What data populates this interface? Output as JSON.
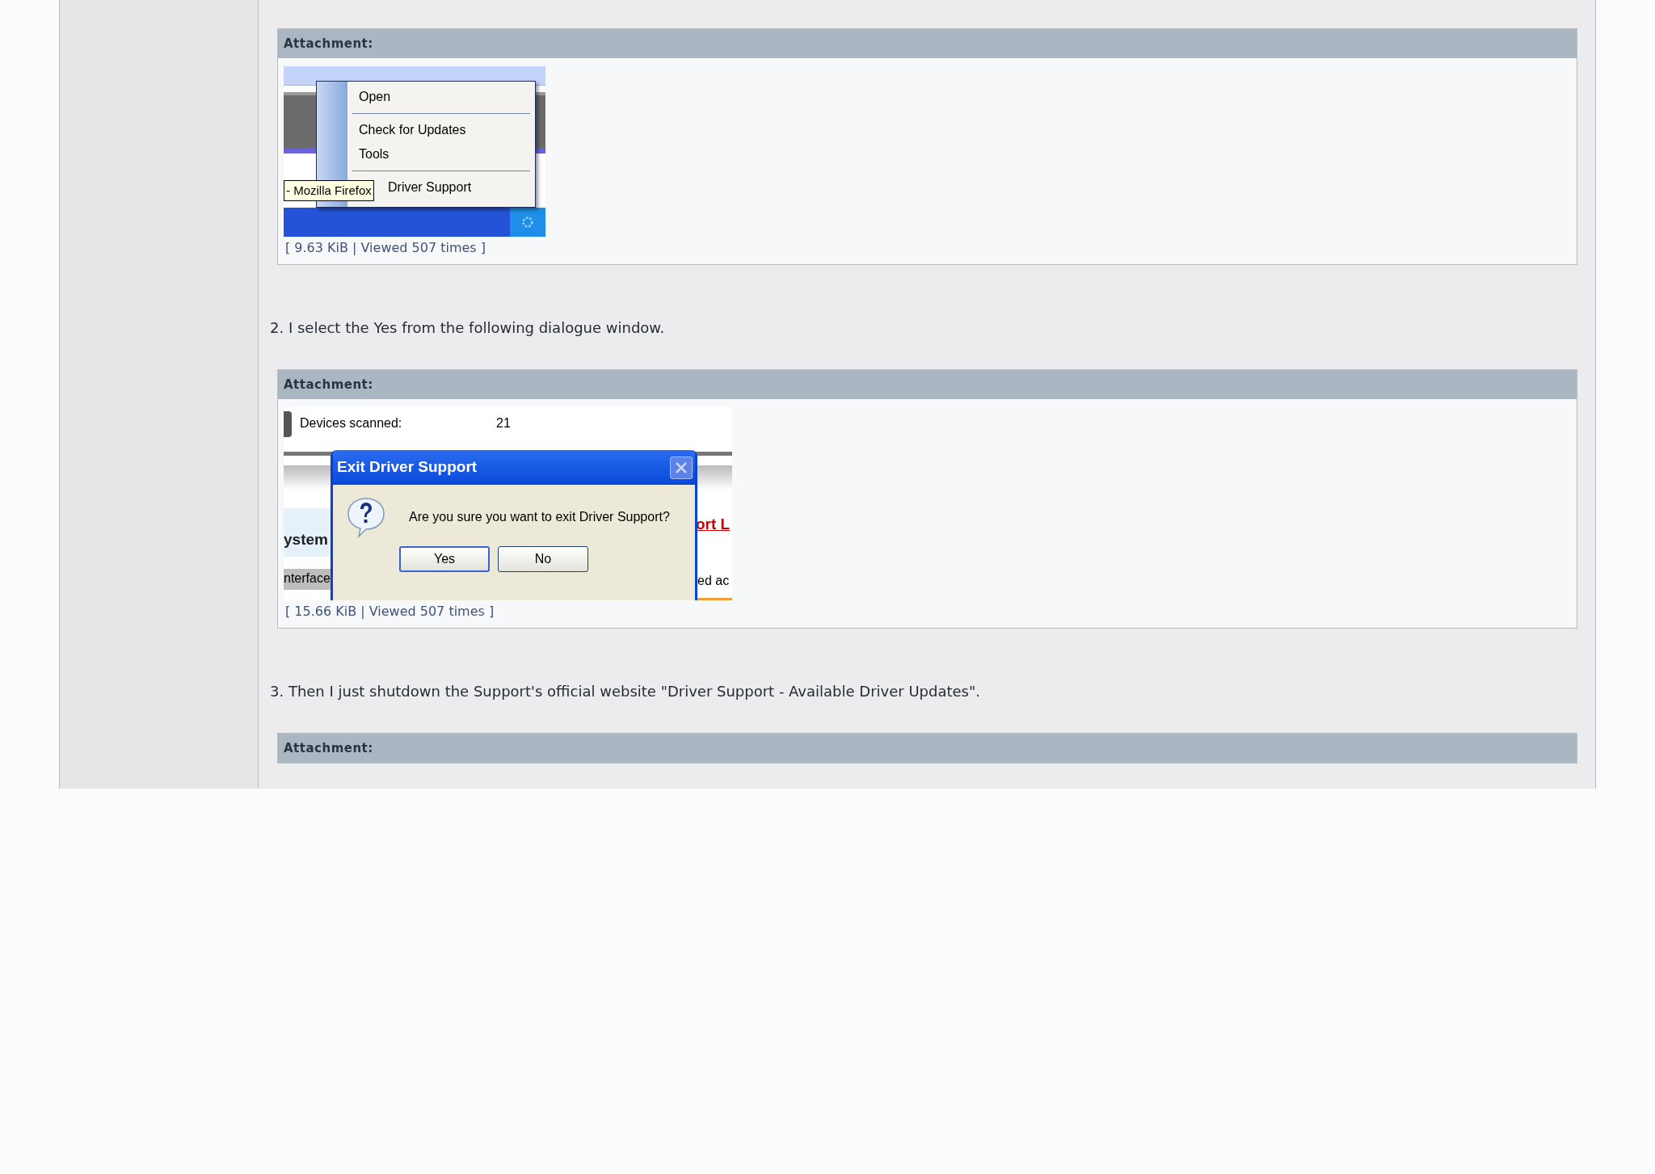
{
  "post": [
    {
      "kind": "attachment",
      "header": "Attachment:",
      "screenshot": {
        "kind": "context-menu",
        "menu": [
          {
            "kind": "item",
            "label": "Open"
          },
          {
            "kind": "separator"
          },
          {
            "kind": "item",
            "label": "Check for Updates"
          },
          {
            "kind": "item",
            "label": "Tools"
          },
          {
            "kind": "separator"
          },
          {
            "kind": "covered-item",
            "label": "Driver Support"
          }
        ],
        "tooltip": "- Mozilla Firefox"
      },
      "meta": "[ 9.63 KiB | Viewed 507 times ]"
    },
    {
      "kind": "paragraph",
      "text": "2. I select the Yes from the following dialogue window."
    },
    {
      "kind": "attachment",
      "header": "Attachment:",
      "screenshot": {
        "kind": "dialog",
        "field_label": "Devices scanned:",
        "field_value": "21",
        "title": "Exit Driver Support",
        "message": "Are you sure you want to exit Driver Support?",
        "buttons": [
          "Yes",
          "No"
        ],
        "fragments": [
          "ystem",
          "nterface",
          "ort L",
          "ed ac"
        ]
      },
      "meta": "[ 15.66 KiB | Viewed 507 times ]"
    },
    {
      "kind": "paragraph",
      "text": "3. Then I just shutdown the Support's official website \"Driver Support - Available Driver Updates\"."
    },
    {
      "kind": "attachment",
      "header": "Attachment:"
    }
  ]
}
